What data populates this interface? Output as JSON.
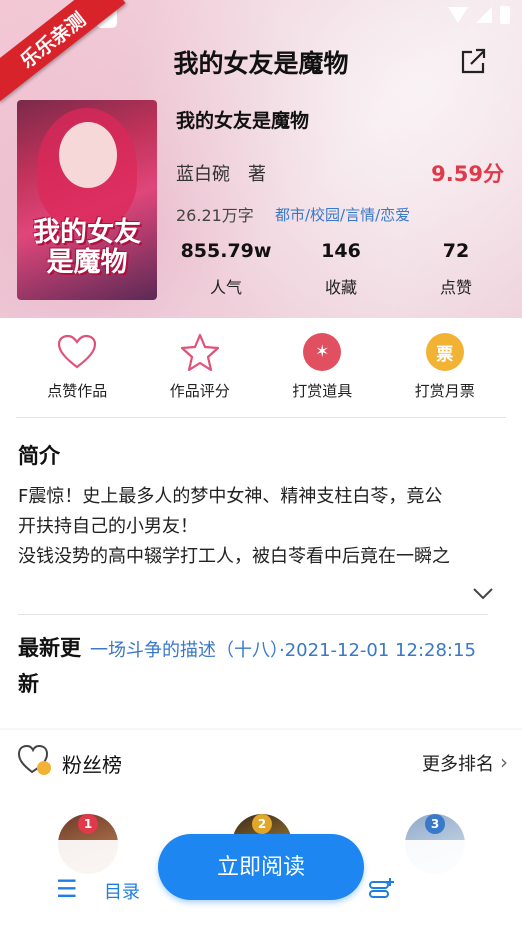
{
  "watermark": "乐乐亲测",
  "header": {
    "title": "我的女友是魔物"
  },
  "book": {
    "cover_text": "我的女友是魔物",
    "name": "我的女友是魔物",
    "author": "蓝白碗　著",
    "score": "9.59分",
    "word_count": "26.21万字",
    "tags": "都市/校园/言情/恋爱",
    "stats": [
      {
        "value": "855.79w",
        "label": "人气"
      },
      {
        "value": "146",
        "label": "收藏"
      },
      {
        "value": "72",
        "label": "点赞"
      }
    ]
  },
  "actions": [
    {
      "label": "点赞作品",
      "icon": "heart-icon"
    },
    {
      "label": "作品评分",
      "icon": "star-icon"
    },
    {
      "label": "打赏道具",
      "icon": "wand-icon"
    },
    {
      "label": "打赏月票",
      "icon": "ticket-icon",
      "glyph": "票"
    }
  ],
  "intro": {
    "title": "简介",
    "lines": [
      "F震惊！史上最多人的梦中女神、精神支柱白苓，竟公",
      "开扶持自己的小男友！",
      "没钱没势的高中辍学打工人，被白苓看中后竟在一瞬之"
    ]
  },
  "latest": {
    "label": "最新更新",
    "text": "一场斗争的描述（十八）·2021-12-01 12:28:15"
  },
  "fans": {
    "title": "粉丝榜",
    "more": "更多排名",
    "ranks": [
      "1",
      "2",
      "3"
    ]
  },
  "bottom": {
    "toc_label": "目录",
    "read_label": "立即阅读"
  },
  "colors": {
    "accent_blue": "#1e86f0",
    "score_red": "#e0394a",
    "tag_blue": "#3a78c9",
    "wand_red": "#e05060",
    "ticket_gold": "#f2b233"
  }
}
